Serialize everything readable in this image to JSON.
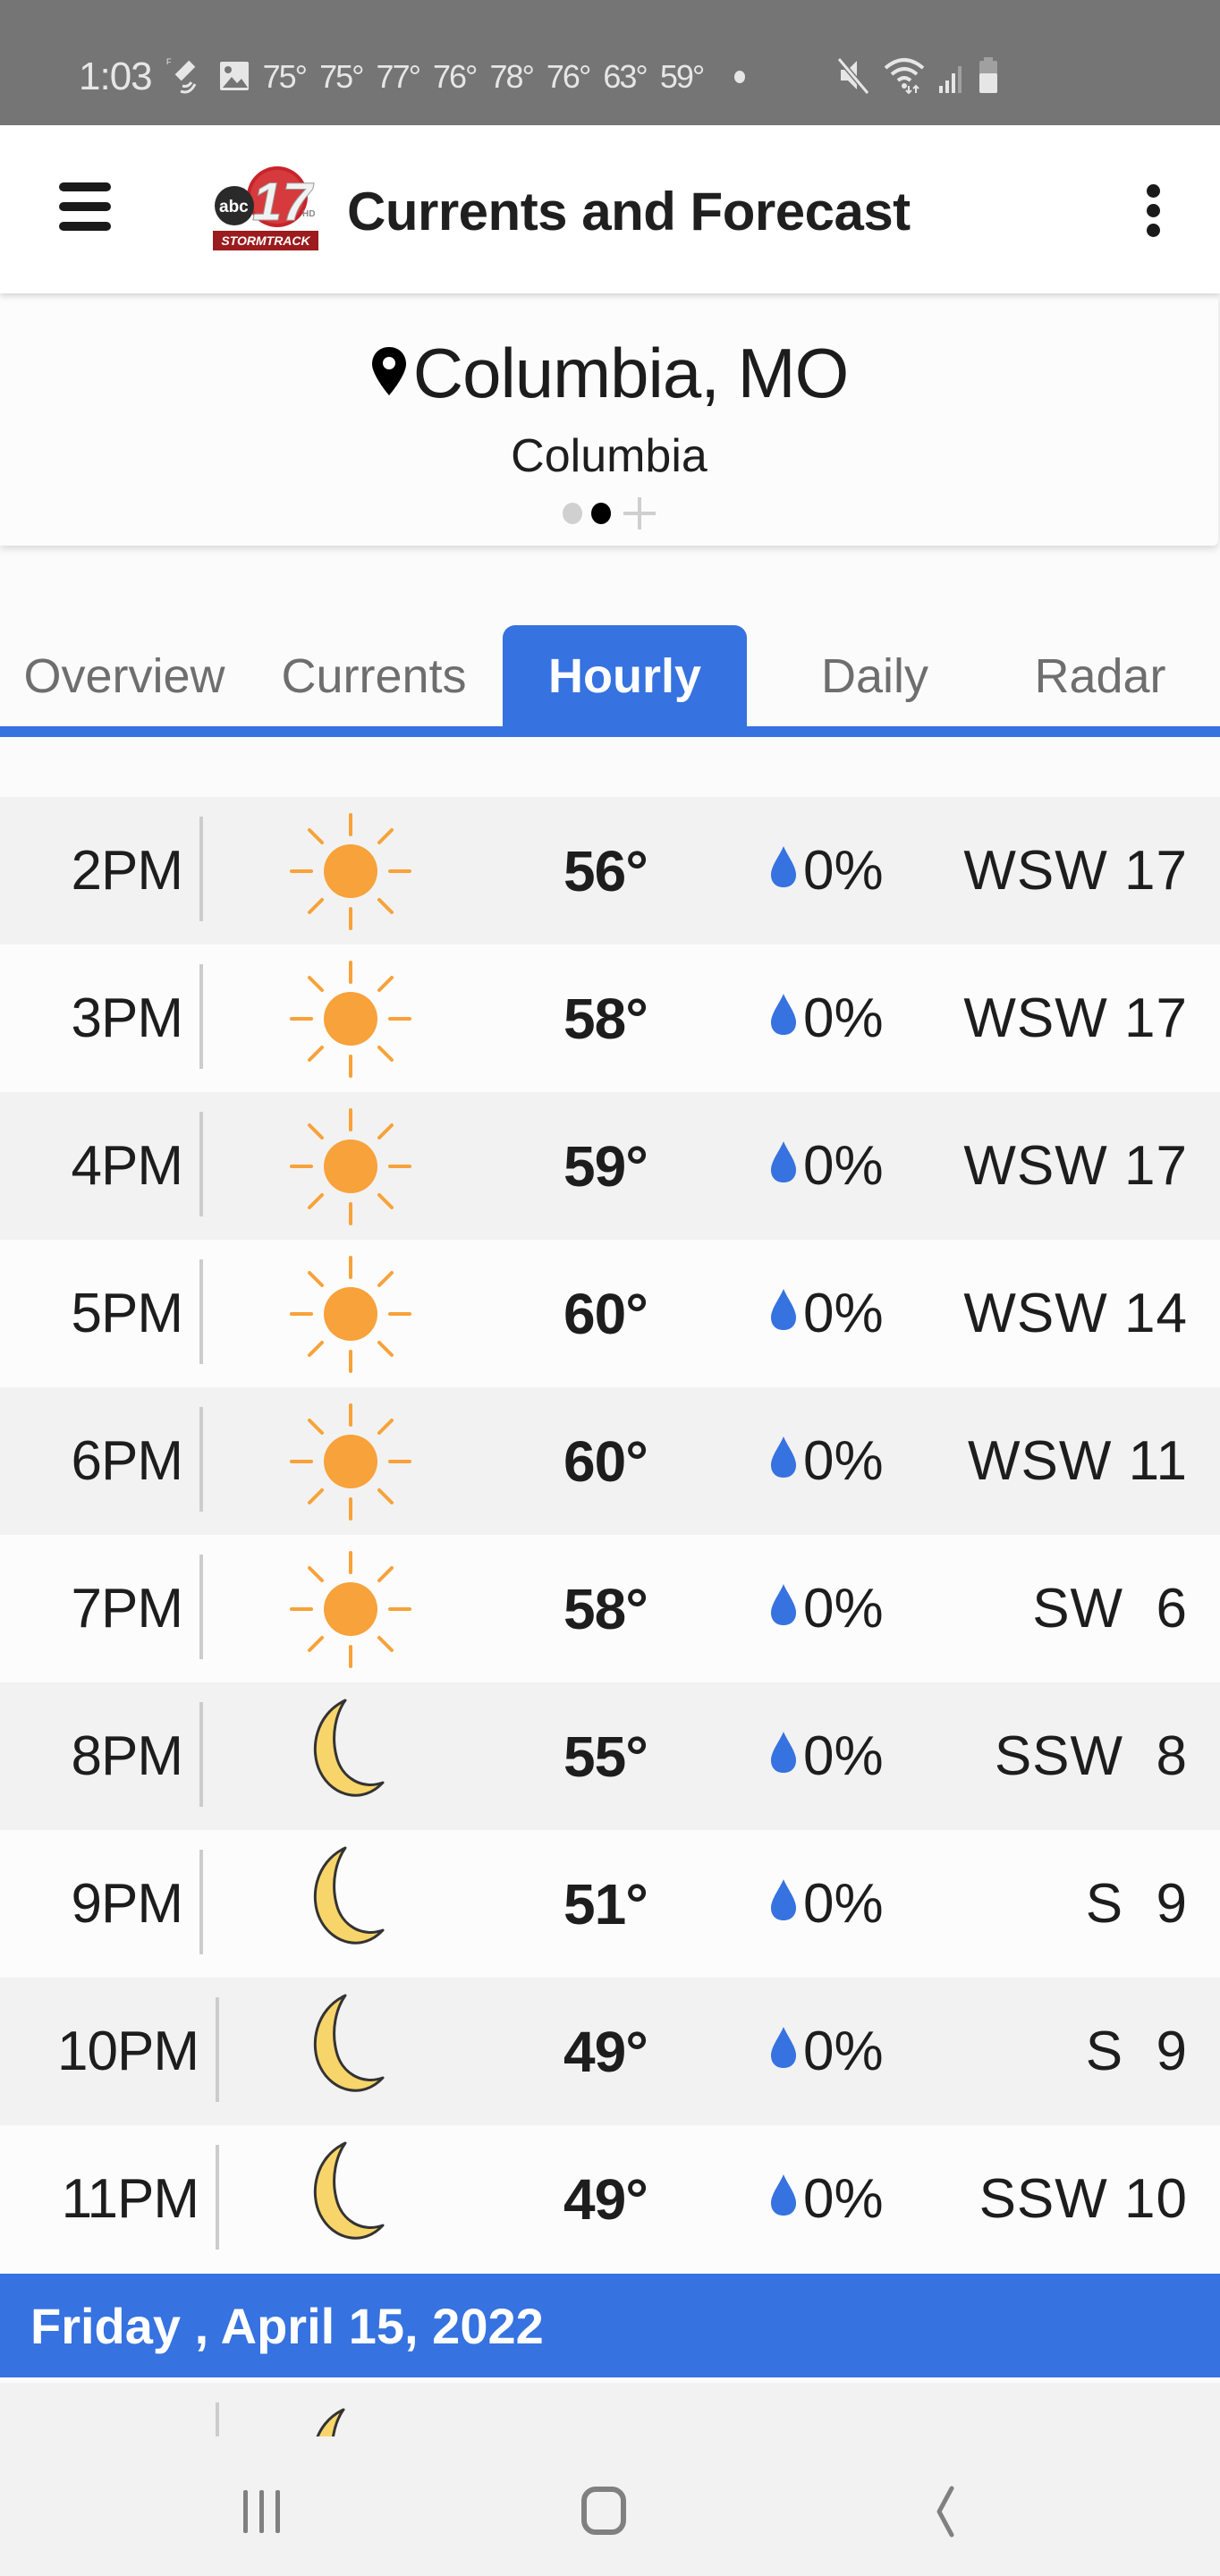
{
  "status_bar": {
    "time": "1:03",
    "notification_temps": [
      "75°",
      "75°",
      "77°",
      "76°",
      "78°",
      "76°",
      "63°",
      "59°"
    ],
    "icons": [
      "satellite-f-icon",
      "gallery-icon",
      "more-dot-icon",
      "mute-icon",
      "wifi-icon",
      "signal-icon",
      "battery-icon"
    ]
  },
  "app_bar": {
    "title": "Currents and Forecast",
    "logo_text": "STORMTRACK",
    "logo_channel": "17",
    "logo_network": "abc"
  },
  "location": {
    "name": "Columbia, MO",
    "subtitle": "Columbia",
    "pager_total": 2,
    "pager_active_index": 1
  },
  "tabs": [
    {
      "label": "Overview",
      "active": false
    },
    {
      "label": "Currents",
      "active": false
    },
    {
      "label": "Hourly",
      "active": true
    },
    {
      "label": "Daily",
      "active": false
    },
    {
      "label": "Radar",
      "active": false
    }
  ],
  "hourly": [
    {
      "time": "2PM",
      "icon": "sun",
      "temp": "56°",
      "precip": "0%",
      "wind": "WSW 17"
    },
    {
      "time": "3PM",
      "icon": "sun",
      "temp": "58°",
      "precip": "0%",
      "wind": "WSW 17"
    },
    {
      "time": "4PM",
      "icon": "sun",
      "temp": "59°",
      "precip": "0%",
      "wind": "WSW 17"
    },
    {
      "time": "5PM",
      "icon": "sun",
      "temp": "60°",
      "precip": "0%",
      "wind": "WSW 14"
    },
    {
      "time": "6PM",
      "icon": "sun",
      "temp": "60°",
      "precip": "0%",
      "wind": "WSW 11"
    },
    {
      "time": "7PM",
      "icon": "sun",
      "temp": "58°",
      "precip": "0%",
      "wind": "SW  6"
    },
    {
      "time": "8PM",
      "icon": "moon",
      "temp": "55°",
      "precip": "0%",
      "wind": "SSW  8"
    },
    {
      "time": "9PM",
      "icon": "moon",
      "temp": "51°",
      "precip": "0%",
      "wind": "S  9"
    },
    {
      "time": "10PM",
      "icon": "moon",
      "temp": "49°",
      "precip": "0%",
      "wind": "S  9"
    },
    {
      "time": "11PM",
      "icon": "moon",
      "temp": "49°",
      "precip": "0%",
      "wind": "SSW 10"
    }
  ],
  "date_header": "Friday , April 15, 2022",
  "colors": {
    "accent": "#3672e0",
    "sun": "#f7a23a",
    "moon": "#f8d56a",
    "precip_drop": "#3672e0",
    "status_bar": "#757575"
  }
}
